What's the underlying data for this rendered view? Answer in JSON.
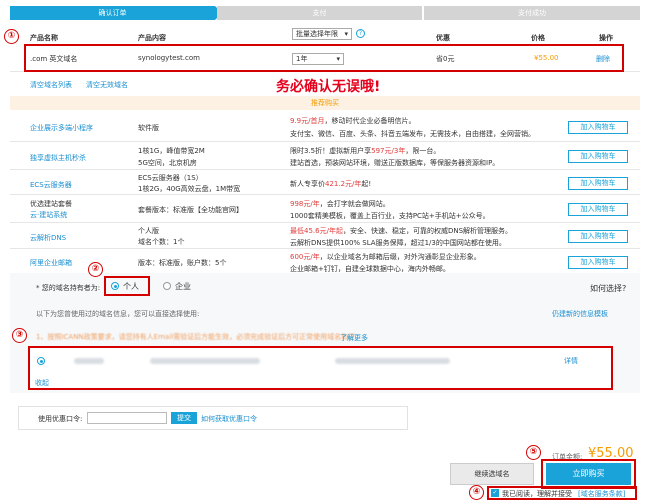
{
  "steps": [
    "确认订单",
    "支付",
    "支付成功"
  ],
  "table_header": {
    "name": "产品名称",
    "content": "产品内容",
    "period_select": "批量选择年限",
    "discount": "优惠",
    "price": "价格",
    "action": "操作"
  },
  "order_row": {
    "name": ".com 英文域名",
    "content": "synologytest.com",
    "period": "1年",
    "discount": "省0元",
    "price": "¥55.00",
    "action": "删除"
  },
  "clear_links": {
    "clear_list": "清空域名列表",
    "clear_invalid": "清空无效域名"
  },
  "warning": "务必确认无误哦!",
  "recommend_title": "推荐购买",
  "recommend": [
    {
      "name": "企业展示多端小程序",
      "content": "软件版",
      "promo_price": "9.9元/首月",
      "promo_text": "，移动时代企业必备明信片。",
      "desc": "支付宝、微信、百度、头条、抖音五端发布，无需技术，自由搭建，全网营销。",
      "button": "加入购物车"
    },
    {
      "name": "独享虚拟主机秒杀",
      "content_lines": [
        "1核1G，峰值带宽2M",
        "5G空间，北京机房"
      ],
      "promo_text_1": "限时3.5折！虚拟新用户享",
      "promo_price": "597元/3年",
      "promo_text_2": "，限一台。",
      "desc": "建站首选，预装网站环境，赠送正版数据库，等保服务器资源和IP。",
      "button": "加入购物车"
    },
    {
      "name": "ECS云服务器",
      "content_lines": [
        "ECS云服务器（1S）",
        "1核2G，40G高效云盘，1M带宽"
      ],
      "promo_text_1": "新人专享价",
      "promo_price": "421.2元/年",
      "promo_text_2": "起!",
      "button": "加入购物车"
    },
    {
      "name": "优选建站套餐",
      "sub_link": "云·建站系统",
      "content": "套餐版本：标准版【全功能官网】",
      "promo_price": "998元/年",
      "promo_text": "，会打字就会做网站。",
      "desc": "1000套精美模板，覆盖上百行业，支持PC站+手机站+公众号。",
      "button": "加入购物车"
    },
    {
      "name": "云解析DNS",
      "content_lines": [
        "个人版",
        "域名个数：1个"
      ],
      "promo_price": "最低45.6元/年起",
      "promo_text": "，安全、快速、稳定，可靠的权威DNS解析管理服务。",
      "desc": "云解析DNS提供100% SLA服务保障，超过1/3的中国网站都在使用。",
      "button": "加入购物车"
    },
    {
      "name": "阿里企业邮箱",
      "content": "版本：标准版，账户数：5个",
      "promo_price": "600元/年",
      "promo_text": "，以企业域名为邮箱后缀，对外沟通彰显企业形象。",
      "desc": "企业邮箱+钉钉，自建全球数据中心，海内外畅邮。",
      "button": "加入购物车"
    }
  ],
  "holder": {
    "label": "* 您的域名持有者为:",
    "personal": "个人",
    "enterprise": "企业",
    "how_choose": "如何选择?",
    "hint": "以下为您曾使用过的域名信息，您可以直接选择使用:",
    "create_link": "仍建新的信息模板"
  },
  "notice": {
    "text": "1、按照ICANN政策要求，请您持有人Email需验证后方能生效，必须完成验证后方可正常使用域名和正常续费等功能；",
    "link": "了解更多"
  },
  "template_row": {
    "action": "详情",
    "collapse": "收起"
  },
  "coupon": {
    "label": "使用优惠口令:",
    "placeholder": "",
    "submit": "提交",
    "how": "如何获取优惠口令"
  },
  "order_total": {
    "label": "订单金额:",
    "amount": "¥55.00"
  },
  "buttons": {
    "continue": "继续选域名",
    "buy_now": "立即购买"
  },
  "agreement": {
    "text": "我已阅读，理解并接受",
    "link": "[域名服务条款]"
  },
  "markers": [
    "①",
    "②",
    "③",
    "④",
    "⑤"
  ]
}
